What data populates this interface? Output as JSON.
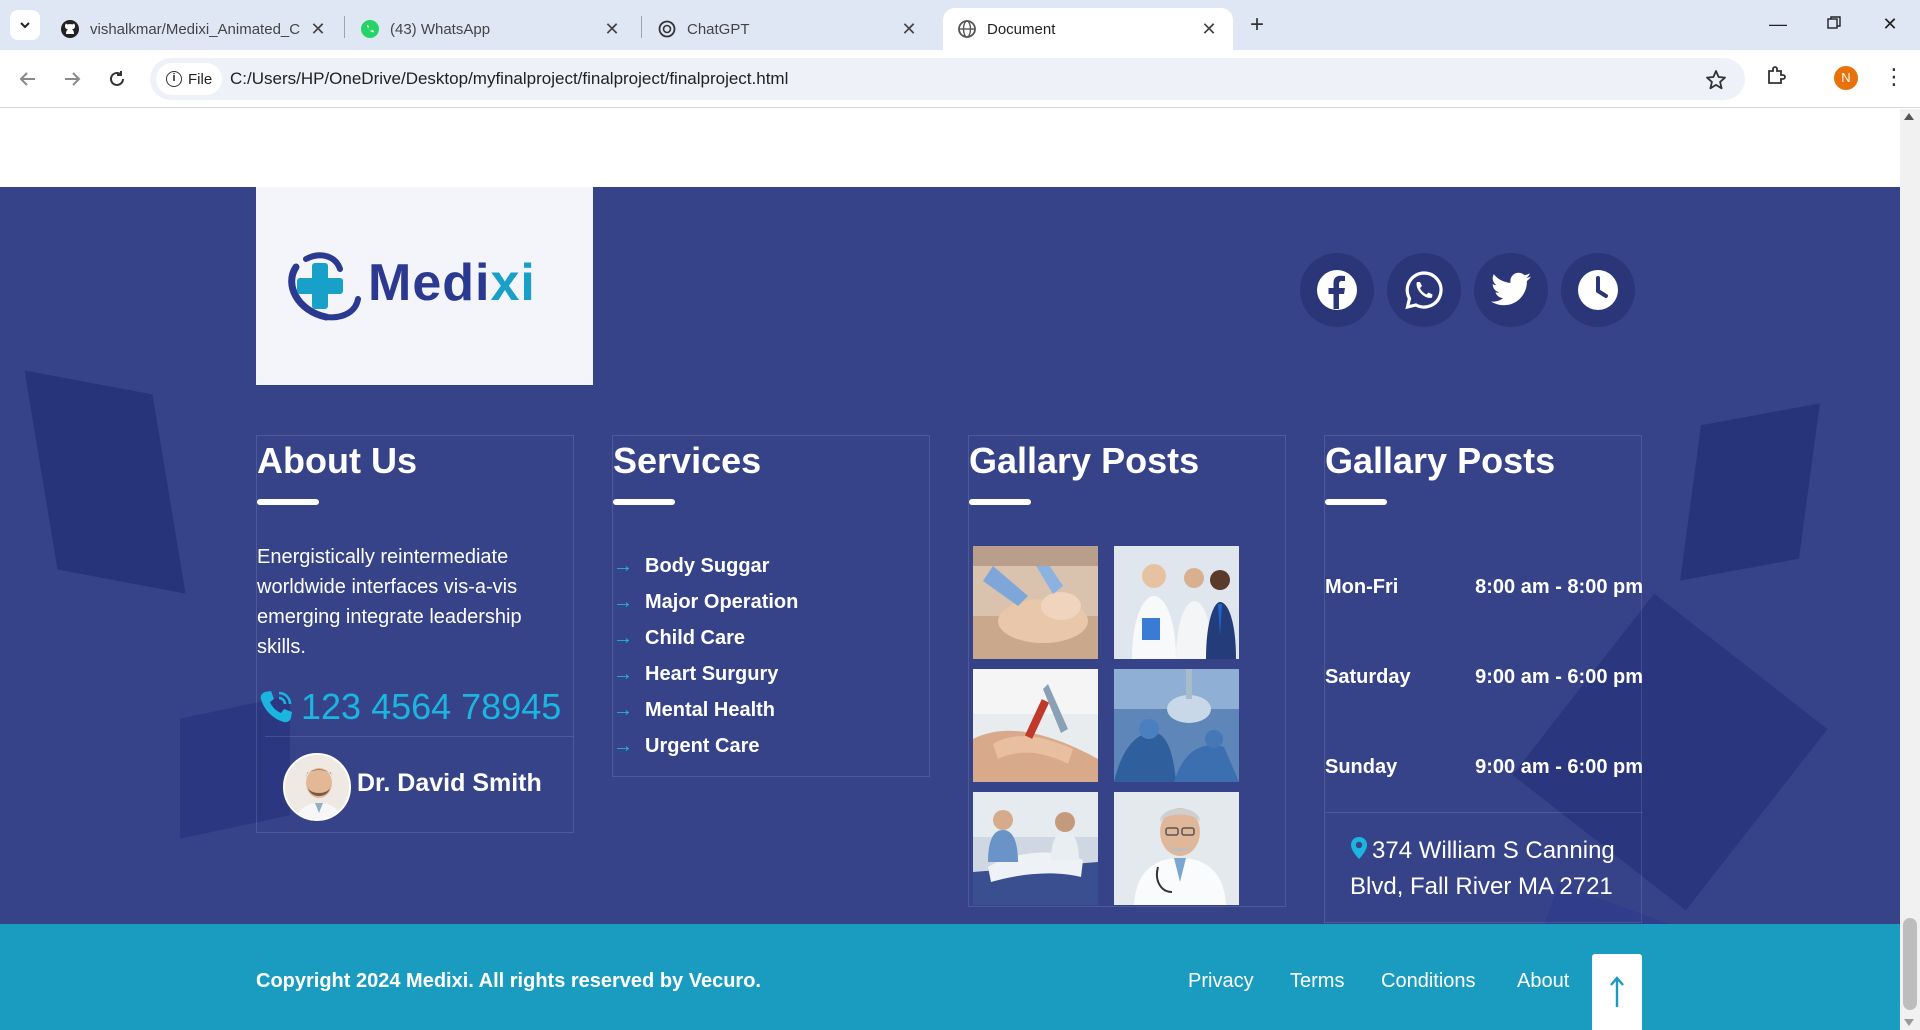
{
  "browser": {
    "tabs": [
      {
        "title": "vishalkmar/Medixi_Animated_C",
        "icon": "github-icon"
      },
      {
        "title": "(43) WhatsApp",
        "icon": "whatsapp-icon"
      },
      {
        "title": "ChatGPT",
        "icon": "chatgpt-icon"
      },
      {
        "title": "Document",
        "icon": "globe-icon",
        "active": true
      }
    ],
    "security_chip": "File",
    "url": "C:/Users/HP/OneDrive/Desktop/myfinalproject/finalproject/finalproject.html",
    "profile_initial": "N"
  },
  "footer": {
    "logo": {
      "text_main": "Medi",
      "text_accent": "xi"
    },
    "social_icons": [
      "facebook-icon",
      "whatsapp-icon",
      "twitter-icon",
      "clock-icon"
    ],
    "about": {
      "title": "About Us",
      "text": "Energistically reintermediate worldwide interfaces vis-a-vis emerging integrate leadership skills.",
      "phone": "123 4564 78945",
      "doctor_name": "Dr. David Smith"
    },
    "services": {
      "title": "Services",
      "items": [
        "Body Suggar",
        "Major Operation",
        "Child Care",
        "Heart Surgury",
        "Mental Health",
        "Urgent Care"
      ]
    },
    "gallery": {
      "title": "Gallary Posts",
      "images": [
        "facial-treatment-photo",
        "doctors-team-photo",
        "blood-test-photo",
        "surgery-room-photo",
        "patient-care-photo",
        "senior-doctor-photo"
      ]
    },
    "hours": {
      "title": "Gallary Posts",
      "rows": [
        {
          "day": "Mon-Fri",
          "time": "8:00 am - 8:00 pm"
        },
        {
          "day": "Saturday",
          "time": "9:00 am - 6:00 pm"
        },
        {
          "day": "Sunday",
          "time": "9:00 am - 6:00 pm"
        }
      ],
      "address": "374 William S Canning Blvd, Fall River MA 2721"
    }
  },
  "bottom_bar": {
    "copyright": "Copyright 2024 Medixi. All rights reserved by Vecuro.",
    "links": [
      "Privacy",
      "Terms",
      "Conditions",
      "About"
    ],
    "back_to_top": "↑"
  },
  "colors": {
    "footer_bg": "#364389",
    "accent": "#1cb5e0",
    "bottom_bar": "#1a9cc1",
    "brand_dark": "#2b3990"
  }
}
